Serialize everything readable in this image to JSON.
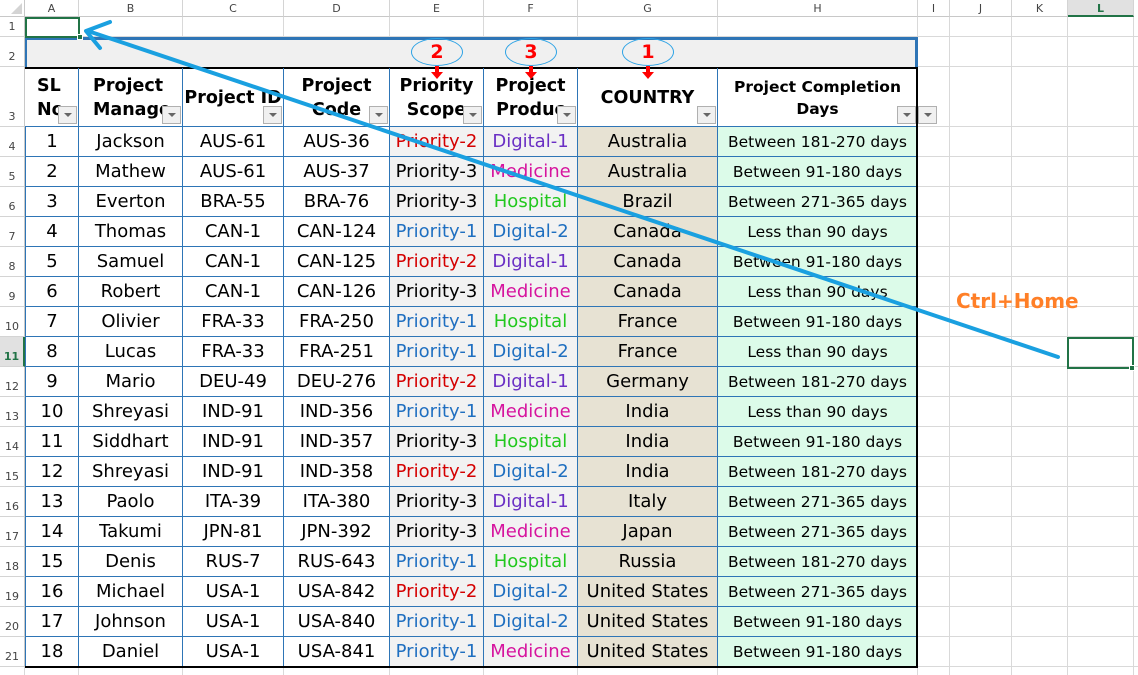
{
  "sheet": {
    "columns": [
      "A",
      "B",
      "C",
      "D",
      "E",
      "F",
      "G",
      "H",
      "I",
      "J",
      "K",
      "L"
    ],
    "selected_column": "L",
    "rows": [
      "1",
      "2",
      "3",
      "4",
      "5",
      "6",
      "7",
      "8",
      "9",
      "10",
      "11",
      "12",
      "13",
      "14",
      "15",
      "16",
      "17",
      "18",
      "19",
      "20",
      "21"
    ],
    "selected_row": "11"
  },
  "table": {
    "headers": {
      "sl_no": "SL No",
      "manager": "Project Manager",
      "project_id": "Project ID",
      "project_code": "Project Code",
      "priority": "Priority Scope",
      "product": "Project Product",
      "country": "COUNTRY",
      "days": "Project Completion Days"
    },
    "header_lines": {
      "sl_no": [
        "SL",
        "No"
      ],
      "manager": [
        "Project",
        "Manage"
      ],
      "project_id": [
        "Project ID"
      ],
      "project_code": [
        "Project",
        "Code"
      ],
      "priority": [
        "Priority",
        "Scope"
      ],
      "product": [
        "Project",
        "Produc"
      ],
      "country": [
        "COUNTRY"
      ],
      "days": [
        "Project Completion",
        "Days"
      ]
    },
    "rows": [
      {
        "sl": "1",
        "manager": "Jackson",
        "id": "AUS-61",
        "code": "AUS-36",
        "priority": "Priority-2",
        "product": "Digital-1",
        "country": "Australia",
        "days": "Between 181-270 days"
      },
      {
        "sl": "2",
        "manager": "Mathew",
        "id": "AUS-61",
        "code": "AUS-37",
        "priority": "Priority-3",
        "product": "Medicine",
        "country": "Australia",
        "days": "Between 91-180 days"
      },
      {
        "sl": "3",
        "manager": "Everton",
        "id": "BRA-55",
        "code": "BRA-76",
        "priority": "Priority-3",
        "product": "Hospital",
        "country": "Brazil",
        "days": "Between 271-365 days"
      },
      {
        "sl": "4",
        "manager": "Thomas",
        "id": "CAN-1",
        "code": "CAN-124",
        "priority": "Priority-1",
        "product": "Digital-2",
        "country": "Canada",
        "days": "Less than 90 days"
      },
      {
        "sl": "5",
        "manager": "Samuel",
        "id": "CAN-1",
        "code": "CAN-125",
        "priority": "Priority-2",
        "product": "Digital-1",
        "country": "Canada",
        "days": "Between 91-180 days"
      },
      {
        "sl": "6",
        "manager": "Robert",
        "id": "CAN-1",
        "code": "CAN-126",
        "priority": "Priority-3",
        "product": "Medicine",
        "country": "Canada",
        "days": "Less than 90 days"
      },
      {
        "sl": "7",
        "manager": "Olivier",
        "id": "FRA-33",
        "code": "FRA-250",
        "priority": "Priority-1",
        "product": "Hospital",
        "country": "France",
        "days": "Between 91-180 days"
      },
      {
        "sl": "8",
        "manager": "Lucas",
        "id": "FRA-33",
        "code": "FRA-251",
        "priority": "Priority-1",
        "product": "Digital-2",
        "country": "France",
        "days": "Less than 90 days"
      },
      {
        "sl": "9",
        "manager": "Mario",
        "id": "DEU-49",
        "code": "DEU-276",
        "priority": "Priority-2",
        "product": "Digital-1",
        "country": "Germany",
        "days": "Between 181-270 days"
      },
      {
        "sl": "10",
        "manager": "Shreyasi",
        "id": "IND-91",
        "code": "IND-356",
        "priority": "Priority-1",
        "product": "Medicine",
        "country": "India",
        "days": "Less than 90 days"
      },
      {
        "sl": "11",
        "manager": "Siddhart",
        "id": "IND-91",
        "code": "IND-357",
        "priority": "Priority-3",
        "product": "Hospital",
        "country": "India",
        "days": "Between 91-180 days"
      },
      {
        "sl": "12",
        "manager": "Shreyasi",
        "id": "IND-91",
        "code": "IND-358",
        "priority": "Priority-2",
        "product": "Digital-2",
        "country": "India",
        "days": "Between 181-270 days"
      },
      {
        "sl": "13",
        "manager": "Paolo",
        "id": "ITA-39",
        "code": "ITA-380",
        "priority": "Priority-3",
        "product": "Digital-1",
        "country": "Italy",
        "days": "Between 271-365 days"
      },
      {
        "sl": "14",
        "manager": "Takumi",
        "id": "JPN-81",
        "code": "JPN-392",
        "priority": "Priority-3",
        "product": "Medicine",
        "country": "Japan",
        "days": "Between 271-365 days"
      },
      {
        "sl": "15",
        "manager": "Denis",
        "id": "RUS-7",
        "code": "RUS-643",
        "priority": "Priority-1",
        "product": "Hospital",
        "country": "Russia",
        "days": "Between 181-270 days"
      },
      {
        "sl": "16",
        "manager": "Michael",
        "id": "USA-1",
        "code": "USA-842",
        "priority": "Priority-2",
        "product": "Digital-2",
        "country": "United States",
        "days": "Between 271-365 days"
      },
      {
        "sl": "17",
        "manager": "Johnson",
        "id": "USA-1",
        "code": "USA-840",
        "priority": "Priority-1",
        "product": "Digital-2",
        "country": "United States",
        "days": "Between 91-180 days"
      },
      {
        "sl": "18",
        "manager": "Daniel",
        "id": "USA-1",
        "code": "USA-841",
        "priority": "Priority-1",
        "product": "Medicine",
        "country": "United States",
        "days": "Between 91-180 days"
      }
    ]
  },
  "text_colors": {
    "Priority-1": "#1f6fc0",
    "Priority-2": "#d40000",
    "Priority-3": "#000000",
    "Digital-1": "#6a2fc4",
    "Digital-2": "#1f6fc0",
    "Medicine": "#d6149e",
    "Hospital": "#22c81e"
  },
  "fill_colors": {
    "priority_column": "#f2f2f2",
    "product_column": "#f2f2f2",
    "country_column": "#e7e2d3",
    "days_column": "#dcfbe9",
    "row2_band": "#f0f0f0"
  },
  "annotations": {
    "sort_order_badges": [
      {
        "column": "country",
        "label": "1"
      },
      {
        "column": "priority",
        "label": "2"
      },
      {
        "column": "product",
        "label": "3"
      }
    ],
    "shortcut_label": "Ctrl+Home",
    "arrow_color": "#1aa0e0",
    "shortcut_color": "#ff7f27"
  }
}
